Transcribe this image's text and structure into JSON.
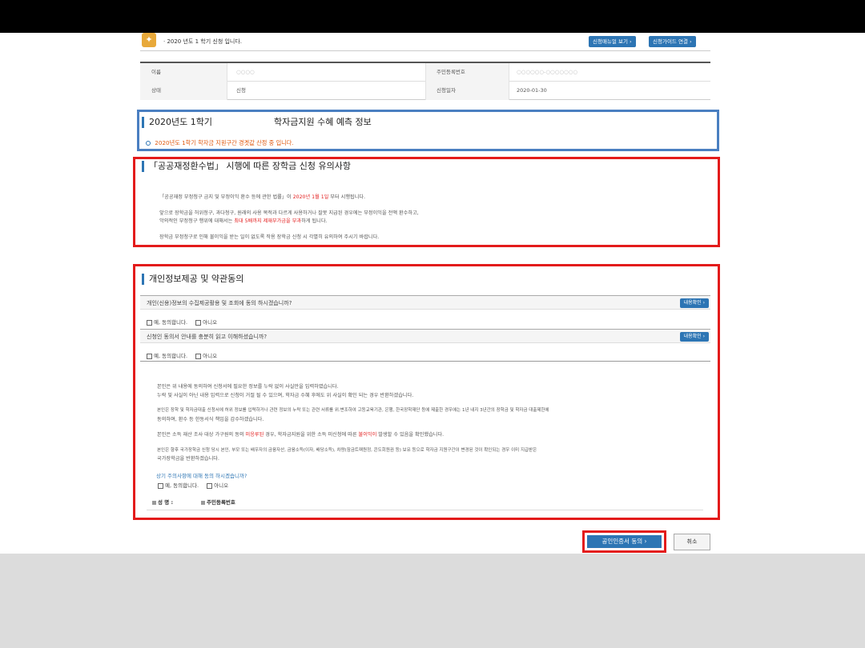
{
  "notice": {
    "text": "· 2020 년도 1 학기 신청 입니다.",
    "manual_btn": "신청매뉴얼 보기 ›",
    "guide_btn": "신청가이드 연결 ›"
  },
  "info_table": {
    "name_label": "이름",
    "name_value": "○○○○",
    "rrn_label": "주민등록번호",
    "rrn_value": "○○○○○○-○○○○○○○",
    "status_label": "상태",
    "status_value": "신청",
    "date_label": "신청일자",
    "date_value": "2020-01-30"
  },
  "prediction": {
    "title_year": "2020년도 1학기",
    "title_main": "학자금지원 수혜 예측 정보",
    "status_text": "2020년도 1학기 학자금 지원구간 경곗값 산정 중 입니다."
  },
  "public_notice": {
    "title": "「공공재정환수법」 시행에 따른 장학금 신청 유의사항",
    "p1_pre": "「공공재정 부정청구 금지 및 부정이익 환수 등에 관한 법률」이 ",
    "p1_date": "2020년 1월 1일",
    "p1_post": " 부터 시행됩니다.",
    "p2": "앞으로 장학금을 허위청구, 과다청구, 원래의 사용 목적과 다르게 사용하거나 잘못 지급된 경우에는 부정이익을 전액 환수하고,",
    "p3_pre": "악의적인 부정청구 행위에 대해서는 ",
    "p3_red": "최대 5배까지 제재부가금을 부과",
    "p3_post": "하게 됩니다.",
    "p4": "장학금 부정청구로 인해 불이익을 받는 일이 없도록 작용 장학금 신청 시 각별히 유의하여 주시기 바랍니다."
  },
  "consent": {
    "title": "개인정보제공 및 약관동의",
    "q1": "개인(신용)정보의 수집제공활용 및 조회에 동의 하시겠습니까?",
    "q2": "신청인 동의서 안내를 충분히 읽고 이해하셨습니까?",
    "check_btn": "내용확인 ›",
    "yes": "예, 동의합니다.",
    "no": "아니오",
    "pledge1": "본인은 위 내용에 동의하여 신청서에 필요한 정보를 누락 없이 사실만을 입력하였습니다.",
    "pledge2": "누락 및 사실이 아닌 내용 입력으로 신청이 거절 될 수 있으며, 학자금 수혜 후에도 위 사실이 확인 되는 경우 반환하겠습니다.",
    "pledge3": "본인은 장학 및 학자금대출 신청서에 허위 정보를 입력하거나 관련 정보의 누락 또는 관련 서류를 위.변조하여 고등교육기관, 은행, 한국장학재단 등에 제출한 경우에는 1년 내지 3년간의 장학금 및 학자금 대출제한에",
    "pledge3b": "동의하며, 환수 등 한동서식 책임을 감수하겠습니다.",
    "pledge4_pre": "본인은 소득 재산 조사 대상 가구원의 동의 ",
    "pledge4_red1": "미응루된",
    "pledge4_mid": " 경우, 학자금지원을 위한 소득 미신청에 따른 ",
    "pledge4_red2": "불이익이",
    "pledge4_post": " 발생할 수 있음을 확인했습니다.",
    "pledge5": "본인은 향후 국가장학금 신청 당시 본인, 부모 또는 배우자의 금융자산, 금융소득(이자, 배당소득), 차량(잠금트렉원정, 콘도회원권 등) 보유 등으로 학자금 지원구간이 변경된 것이 확인되는 경우 이미 지급받은",
    "pledge5b": "국가장학금을 반환하겠습니다.",
    "final_q": "상기 주의사항에 대해 동의 하시겠습니까?",
    "final_yes": "예, 동의합니다.",
    "final_no": "아니오",
    "sig_name": "성 명 :",
    "sig_rrn": "주민등록번호"
  },
  "actions": {
    "submit": "공인인증서 동의 ›",
    "cancel": "취소"
  },
  "colors": {
    "accent_blue": "#2d75b4",
    "highlight_red": "#e31b1b",
    "highlight_orange": "#e05a10",
    "frame_blue": "#4a7fc1"
  }
}
